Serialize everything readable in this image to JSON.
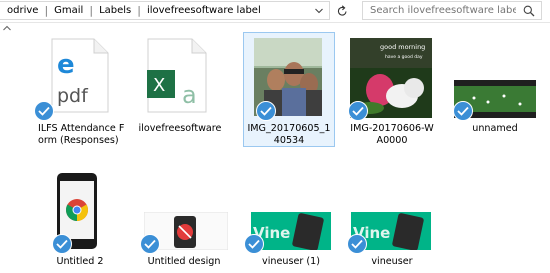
{
  "address": {
    "breadcrumbs": [
      "odrive",
      "Gmail",
      "Labels",
      "ilovefreesoftware label"
    ],
    "separator": "|"
  },
  "search": {
    "placeholder": "Search ilovefreesoftware label"
  },
  "files": [
    {
      "name": "ILFS Attendance Form (Responses)",
      "icon": "pdf-file-icon",
      "selected": false
    },
    {
      "name": "ilovefreesoftware",
      "icon": "excel-file-icon",
      "selected": false
    },
    {
      "name": "IMG_20170605_140534",
      "icon": "photo-thumbnail",
      "selected": true
    },
    {
      "name": "IMG-20170606-WA0000",
      "icon": "photo-thumbnail",
      "selected": false,
      "thumb_text": [
        "good morning",
        "have a good day"
      ]
    },
    {
      "name": "unnamed",
      "icon": "photo-thumbnail",
      "selected": false
    },
    {
      "name": "Untitled 2",
      "icon": "phone-thumbnail",
      "selected": false
    },
    {
      "name": "Untitled design",
      "icon": "watch-thumbnail",
      "selected": false
    },
    {
      "name": "vineuser (1)",
      "icon": "vine-thumbnail",
      "selected": false,
      "thumb_text": "Vine"
    },
    {
      "name": "vineuser",
      "icon": "vine-thumbnail",
      "selected": false,
      "thumb_text": "Vine"
    }
  ],
  "colors": {
    "check": "#3b8fd6",
    "selection": "#e8f3fd",
    "selection_border": "#9bc8f0",
    "excel": "#1e7145",
    "pdf_logo": "#1e88d8",
    "vine": "#00b488"
  }
}
